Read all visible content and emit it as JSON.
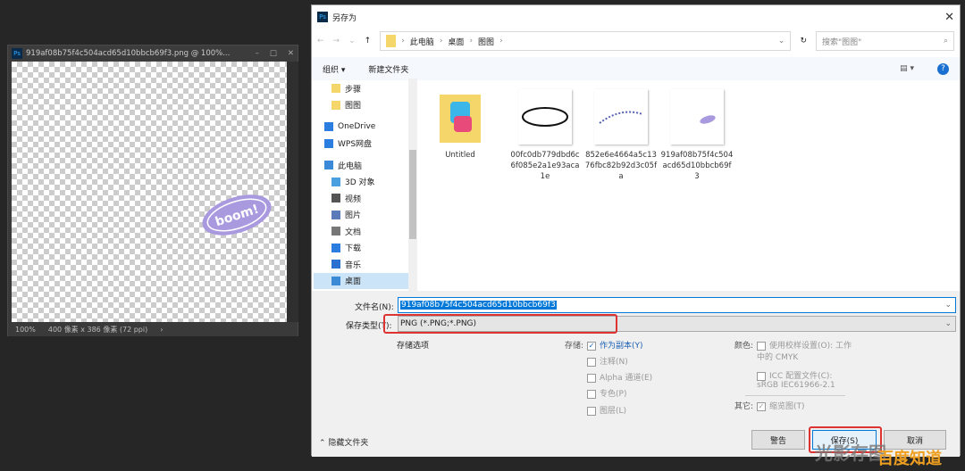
{
  "ps_doc": {
    "title": "919af08b75f4c504acd65d10bbcb69f3.png @ 100%...",
    "status_zoom": "100%",
    "status_info": "400 像素 x 386 像素 (72 ppi)",
    "canvas_stamp": "boom!",
    "stamp_color": "#a99ae0"
  },
  "dialog": {
    "title": "另存为",
    "breadcrumb": [
      "此电脑",
      "桌面",
      "图图"
    ],
    "search_placeholder": "搜索\"图图\"",
    "toolbar": {
      "organize": "组织 ▾",
      "new_folder": "新建文件夹"
    },
    "nav": [
      {
        "label": "步骤",
        "icon": "folder-icon"
      },
      {
        "label": "图图",
        "icon": "folder-icon"
      },
      {
        "label": "OneDrive",
        "icon": "cloud-icon"
      },
      {
        "label": "WPS网盘",
        "icon": "cloud-icon"
      },
      {
        "label": "此电脑",
        "icon": "computer-icon"
      },
      {
        "label": "3D 对象",
        "icon": "cube-icon"
      },
      {
        "label": "视频",
        "icon": "video-icon"
      },
      {
        "label": "图片",
        "icon": "picture-icon"
      },
      {
        "label": "文档",
        "icon": "document-icon"
      },
      {
        "label": "下载",
        "icon": "download-icon"
      },
      {
        "label": "音乐",
        "icon": "music-icon"
      },
      {
        "label": "桌面",
        "icon": "desktop-icon"
      }
    ],
    "files": [
      {
        "name": "Untitled"
      },
      {
        "name": "00fc0db779dbd6c6f085e2a1e93aca1e"
      },
      {
        "name": "852e6e4664a5c1376fbc82b92d3c05fa"
      },
      {
        "name": "919af08b75f4c504acd65d10bbcb69f3"
      }
    ],
    "filename_label": "文件名(N):",
    "filename_value": "919af08b75f4c504acd65d10bbcb69f3",
    "type_label": "保存类型(T):",
    "type_value": "PNG (*.PNG;*.PNG)",
    "options": {
      "section": "存储选项",
      "save_label": "存储:",
      "as_copy": "作为副本(Y)",
      "notes": "注释(N)",
      "alpha": "Alpha 通道(E)",
      "spot": "专色(P)",
      "layers": "图层(L)",
      "color_label": "颜色:",
      "proof": "使用校样设置(O): 工作中的 CMYK",
      "icc": "ICC 配置文件(C): sRGB IEC61966-2.1",
      "other_label": "其它:",
      "thumbnail": "缩览图(T)"
    },
    "hide_folders": "隐藏文件夹",
    "warning_btn": "警告",
    "save_btn": "保存(S)",
    "cancel_btn": "取消"
  },
  "watermark": {
    "text1": "光影存图",
    "text2": "百度知道"
  }
}
